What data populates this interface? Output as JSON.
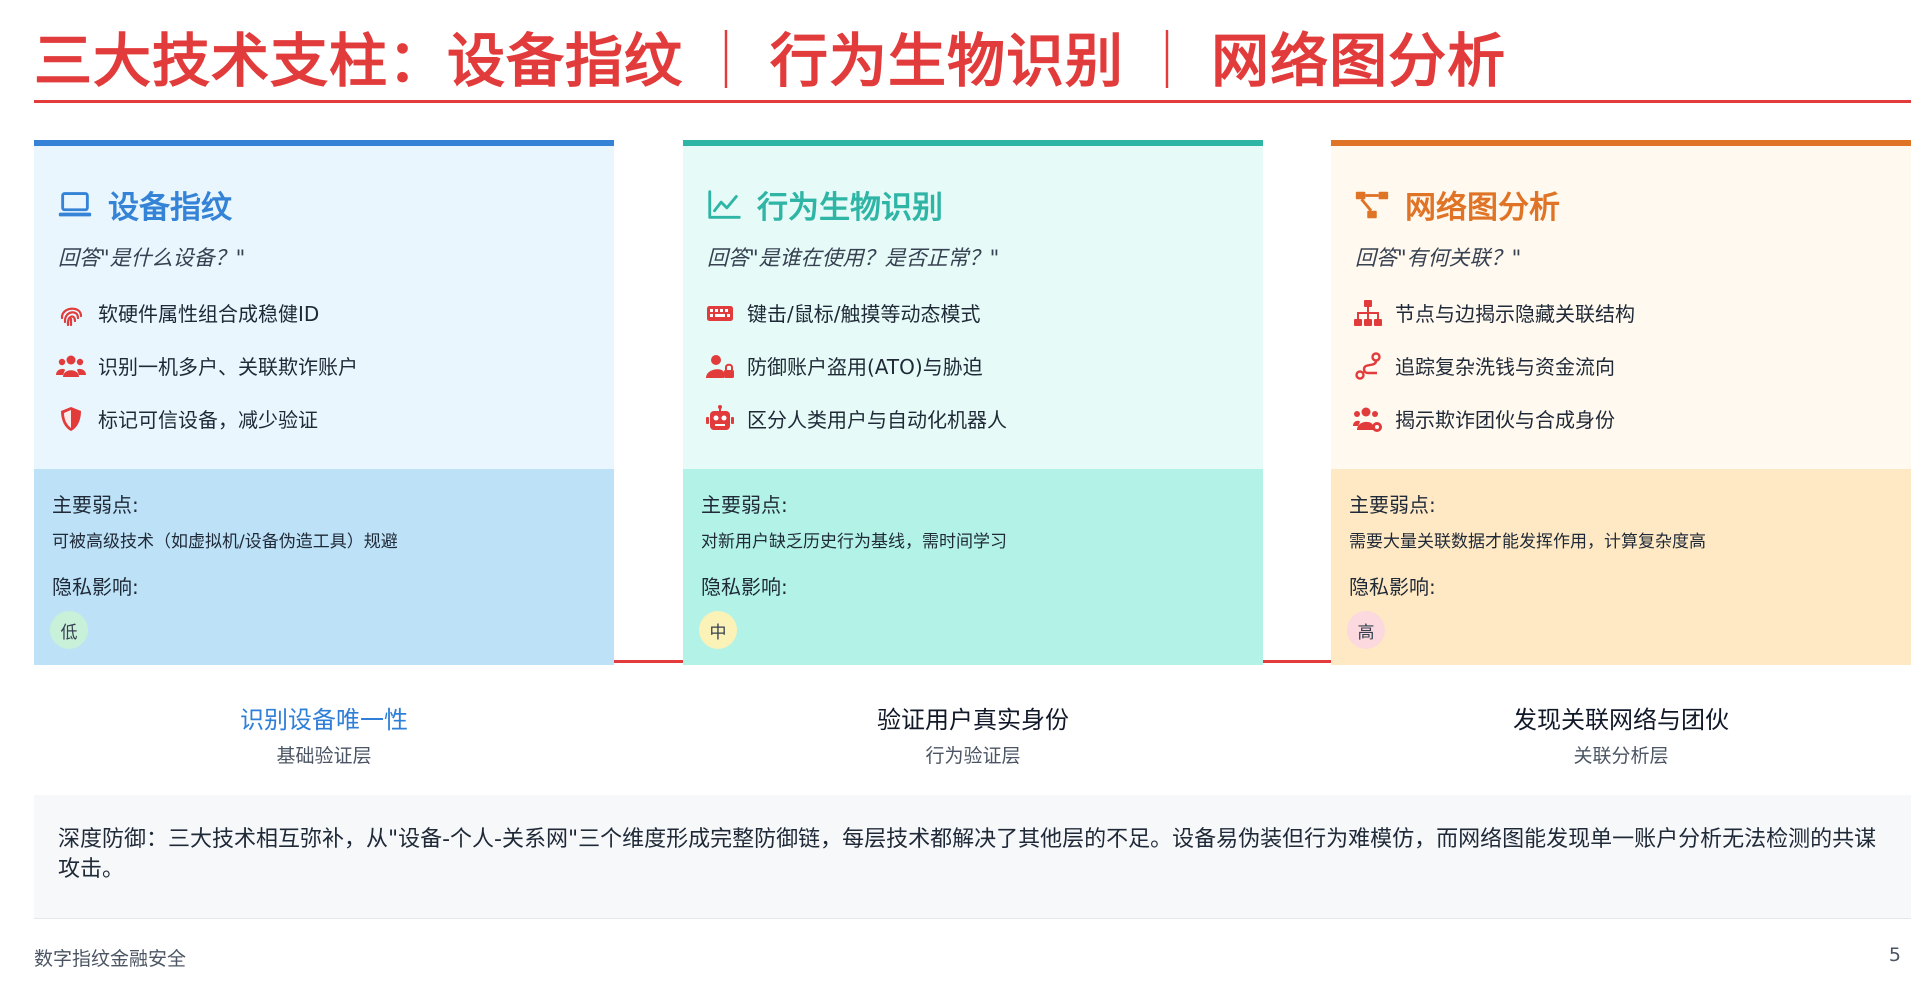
{
  "title": {
    "part1": "三大技术支柱：设备指纹",
    "sep1": "｜",
    "part2": "行为生物识别",
    "sep2": "｜",
    "part3": "网络图分析"
  },
  "colors": {
    "accent": "#e23b3b",
    "device": "#3483d6",
    "behavior": "#2fb5a6",
    "graph": "#e07426"
  },
  "cards": [
    {
      "title": "设备指纹",
      "question": "回答\"是什么设备？\"",
      "header_icon": "laptop-icon",
      "features": [
        {
          "icon": "fingerprint-icon",
          "text": "软硬件属性组合成稳健ID"
        },
        {
          "icon": "users-icon",
          "text": "识别一机多户、关联欺诈账户"
        },
        {
          "icon": "shield-icon",
          "text": "标记可信设备，减少验证"
        }
      ],
      "weakness_label": "主要弱点:",
      "weakness": "可被高级技术（如虚拟机/设备伪造工具）规避",
      "privacy_label": "隐私影响:",
      "privacy": "低"
    },
    {
      "title": "行为生物识别",
      "question": "回答\"是谁在使用？是否正常？\"",
      "header_icon": "line-chart-icon",
      "features": [
        {
          "icon": "keyboard-icon",
          "text": "键击/鼠标/触摸等动态模式"
        },
        {
          "icon": "user-lock-icon",
          "text": "防御账户盗用(ATO)与胁迫"
        },
        {
          "icon": "robot-icon",
          "text": "区分人类用户与自动化机器人"
        }
      ],
      "weakness_label": "主要弱点:",
      "weakness": "对新用户缺乏历史行为基线，需时间学习",
      "privacy_label": "隐私影响:",
      "privacy": "中"
    },
    {
      "title": "网络图分析",
      "question": "回答\"有何关联？\"",
      "header_icon": "network-icon",
      "features": [
        {
          "icon": "sitemap-icon",
          "text": "节点与边揭示隐藏关联结构"
        },
        {
          "icon": "route-icon",
          "text": "追踪复杂洗钱与资金流向"
        },
        {
          "icon": "users-gear-icon",
          "text": "揭示欺诈团伙与合成身份"
        }
      ],
      "weakness_label": "主要弱点:",
      "weakness": "需要大量关联数据才能发挥作用，计算复杂度高",
      "privacy_label": "隐私影响:",
      "privacy": "高"
    }
  ],
  "layers": [
    {
      "title": "识别设备唯一性",
      "subtitle": "基础验证层"
    },
    {
      "title": "验证用户真实身份",
      "subtitle": "行为验证层"
    },
    {
      "title": "发现关联网络与团伙",
      "subtitle": "关联分析层"
    }
  ],
  "note": "深度防御：三大技术相互弥补，从\"设备-个人-关系网\"三个维度形成完整防御链，每层技术都解决了其他层的不足。设备易伪装但行为难模仿，而网络图能发现单一账户分析无法检测的共谋攻击。",
  "footer": {
    "left": "数字指纹金融安全",
    "page": "5"
  }
}
